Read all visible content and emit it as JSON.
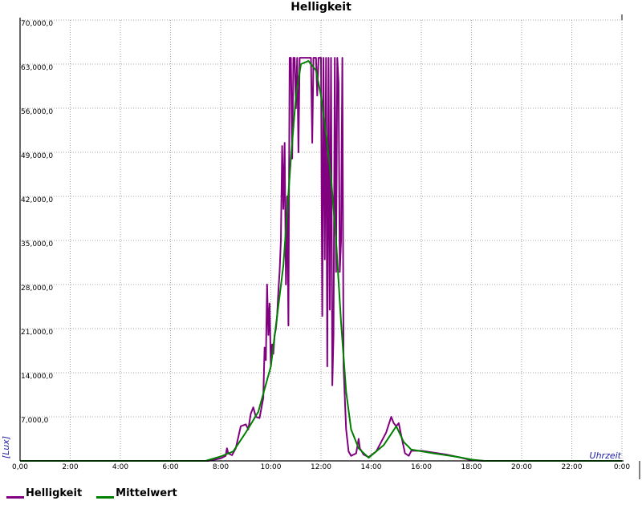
{
  "chart_data": {
    "type": "line",
    "title": "Helligkeit",
    "xlabel": "Uhrzeit",
    "ylabel": "[Lux]",
    "xlim": [
      0,
      24
    ],
    "ylim": [
      0,
      70000
    ],
    "x_ticks": [
      "0,00",
      "2:00",
      "4:00",
      "6:00",
      "8:00",
      "10:00",
      "12:00",
      "14:00",
      "16:00",
      "18:00",
      "20:00",
      "22:00",
      "0:00"
    ],
    "y_ticks": [
      "0,0",
      "7,000,0",
      "14,000,0",
      "21,000,0",
      "28,000,0",
      "35,000,0",
      "42,000,0",
      "49,000,0",
      "56,000,0",
      "63,000,0",
      "70,000,0"
    ],
    "grid": true,
    "legend_position": "bottom-left",
    "series": [
      {
        "name": "Helligkeit",
        "color": "#800080",
        "points": [
          [
            0,
            0
          ],
          [
            7.5,
            0
          ],
          [
            8.0,
            400
          ],
          [
            8.2,
            800
          ],
          [
            8.25,
            2000
          ],
          [
            8.3,
            1200
          ],
          [
            8.45,
            900
          ],
          [
            8.6,
            2000
          ],
          [
            8.8,
            5500
          ],
          [
            9.0,
            5800
          ],
          [
            9.1,
            5000
          ],
          [
            9.2,
            7500
          ],
          [
            9.3,
            8500
          ],
          [
            9.4,
            7000
          ],
          [
            9.55,
            6800
          ],
          [
            9.7,
            10000
          ],
          [
            9.75,
            18000
          ],
          [
            9.8,
            16000
          ],
          [
            9.85,
            28000
          ],
          [
            9.9,
            20000
          ],
          [
            9.95,
            25000
          ],
          [
            10.0,
            15000
          ],
          [
            10.05,
            18500
          ],
          [
            10.1,
            17000
          ],
          [
            10.15,
            20000
          ],
          [
            10.2,
            21000
          ],
          [
            10.25,
            23000
          ],
          [
            10.3,
            27000
          ],
          [
            10.35,
            30000
          ],
          [
            10.4,
            35000
          ],
          [
            10.45,
            50000
          ],
          [
            10.5,
            40000
          ],
          [
            10.55,
            50500
          ],
          [
            10.6,
            28000
          ],
          [
            10.65,
            42000
          ],
          [
            10.7,
            21500
          ],
          [
            10.75,
            64000
          ],
          [
            10.8,
            64000
          ],
          [
            10.85,
            48000
          ],
          [
            10.9,
            64000
          ],
          [
            10.95,
            64000
          ],
          [
            11.0,
            56000
          ],
          [
            11.05,
            64000
          ],
          [
            11.1,
            49000
          ],
          [
            11.15,
            64000
          ],
          [
            11.6,
            64000
          ],
          [
            11.65,
            50500
          ],
          [
            11.7,
            64000
          ],
          [
            11.8,
            64000
          ],
          [
            11.85,
            58000
          ],
          [
            11.9,
            64000
          ],
          [
            12.0,
            64000
          ],
          [
            12.05,
            23000
          ],
          [
            12.1,
            64000
          ],
          [
            12.15,
            32000
          ],
          [
            12.2,
            64000
          ],
          [
            12.25,
            15000
          ],
          [
            12.3,
            64000
          ],
          [
            12.35,
            24000
          ],
          [
            12.4,
            64000
          ],
          [
            12.45,
            12000
          ],
          [
            12.5,
            20000
          ],
          [
            12.55,
            64000
          ],
          [
            12.6,
            30000
          ],
          [
            12.65,
            64000
          ],
          [
            12.7,
            60000
          ],
          [
            12.75,
            30000
          ],
          [
            12.8,
            35000
          ],
          [
            12.85,
            64000
          ],
          [
            12.9,
            15000
          ],
          [
            13.0,
            5000
          ],
          [
            13.1,
            1500
          ],
          [
            13.2,
            800
          ],
          [
            13.4,
            1200
          ],
          [
            13.5,
            3500
          ],
          [
            13.55,
            2000
          ],
          [
            13.7,
            1000
          ],
          [
            13.9,
            600
          ],
          [
            14.2,
            1500
          ],
          [
            14.6,
            4500
          ],
          [
            14.8,
            7000
          ],
          [
            14.9,
            6000
          ],
          [
            15.0,
            5500
          ],
          [
            15.1,
            6000
          ],
          [
            15.2,
            4000
          ],
          [
            15.35,
            1200
          ],
          [
            15.5,
            800
          ],
          [
            15.6,
            1600
          ],
          [
            16.0,
            1600
          ],
          [
            17.0,
            1000
          ],
          [
            17.6,
            500
          ],
          [
            18.0,
            100
          ],
          [
            18.5,
            0
          ],
          [
            24,
            0
          ]
        ]
      },
      {
        "name": "Mittelwert",
        "color": "#008000",
        "points": [
          [
            0,
            0
          ],
          [
            7.4,
            0
          ],
          [
            8.0,
            700
          ],
          [
            8.5,
            1500
          ],
          [
            9.0,
            4500
          ],
          [
            9.5,
            7800
          ],
          [
            10.0,
            15000
          ],
          [
            10.5,
            31000
          ],
          [
            10.8,
            48000
          ],
          [
            11.0,
            58000
          ],
          [
            11.2,
            63000
          ],
          [
            11.5,
            63500
          ],
          [
            11.8,
            62000
          ],
          [
            12.0,
            58000
          ],
          [
            12.2,
            52000
          ],
          [
            12.4,
            45000
          ],
          [
            12.6,
            35000
          ],
          [
            12.8,
            22000
          ],
          [
            13.0,
            11000
          ],
          [
            13.2,
            5000
          ],
          [
            13.5,
            2000
          ],
          [
            13.9,
            500
          ],
          [
            14.5,
            2500
          ],
          [
            15.0,
            5500
          ],
          [
            15.3,
            3000
          ],
          [
            15.6,
            1800
          ],
          [
            16.5,
            1200
          ],
          [
            17.5,
            600
          ],
          [
            18.0,
            200
          ],
          [
            18.5,
            0
          ],
          [
            24,
            0
          ]
        ]
      }
    ]
  },
  "legend": {
    "items": [
      {
        "label": "Helligkeit",
        "color": "#800080"
      },
      {
        "label": "Mittelwert",
        "color": "#008000"
      }
    ]
  }
}
